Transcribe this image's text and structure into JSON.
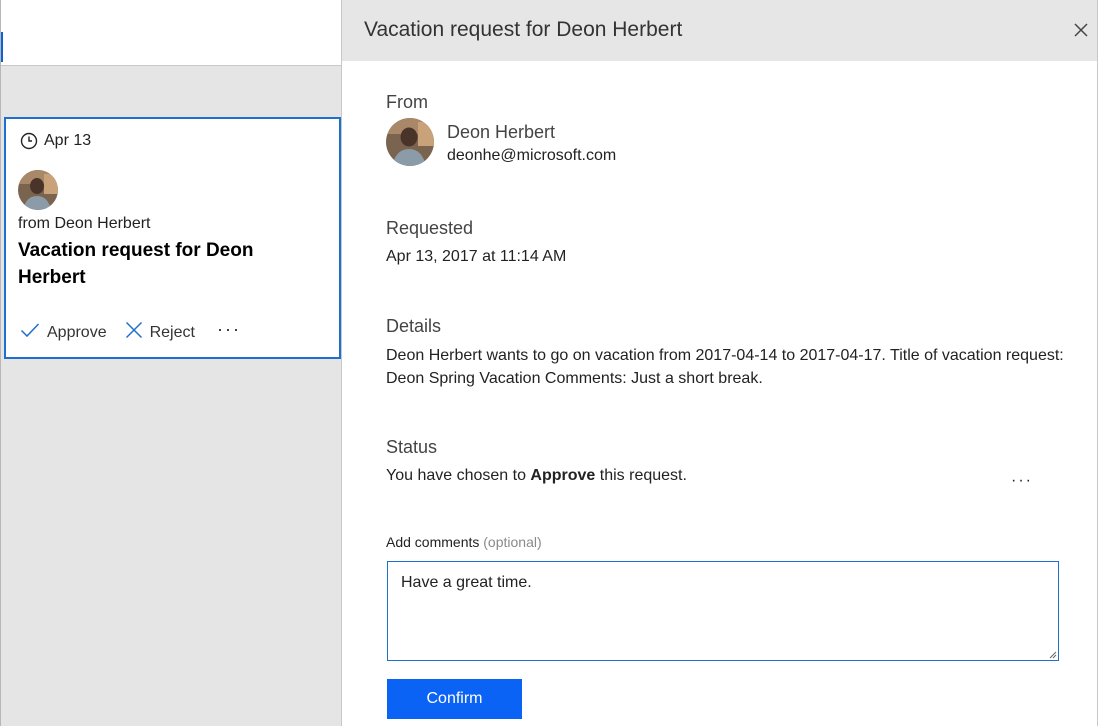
{
  "list": {
    "card": {
      "date": "Apr 13",
      "from": "from Deon Herbert",
      "title": "Vacation request for Deon Herbert",
      "approve_label": "Approve",
      "reject_label": "Reject",
      "more_label": "···"
    }
  },
  "panel": {
    "title": "Vacation request for Deon Herbert",
    "from_label": "From",
    "sender_name": "Deon Herbert",
    "sender_email": "deonhe@microsoft.com",
    "requested_label": "Requested",
    "requested_value": "Apr 13, 2017 at 11:14 AM",
    "details_label": "Details",
    "details_value": "Deon Herbert wants to go on vacation from 2017-04-14 to 2017-04-17. Title of vacation request: Deon Spring Vacation Comments: Just a short break.",
    "status_label": "Status",
    "status_prefix": "You have chosen to ",
    "status_action": "Approve",
    "status_suffix": " this request.",
    "more_label": "···",
    "comments_label": "Add comments",
    "comments_optional": "(optional)",
    "comments_value": "Have a great time.",
    "confirm_label": "Confirm"
  },
  "icons": {
    "clock": "clock-icon",
    "approve": "checkmark-icon",
    "reject": "x-icon",
    "close": "close-icon",
    "avatar": "avatar"
  },
  "colors": {
    "accent": "#1f6fd1",
    "confirm_button": "#0b63f6",
    "header_bg": "#e6e6e6",
    "pane_bg": "#e5e5e5"
  }
}
